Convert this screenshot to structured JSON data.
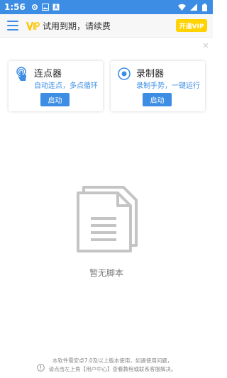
{
  "status_bar": {
    "time": "1:56",
    "icons": [
      "gear-icon",
      "image-icon",
      "text-icon",
      "wifi-icon",
      "signal-icon",
      "battery-icon"
    ]
  },
  "app_bar": {
    "trial_text": "试用到期，请续费",
    "vip_button": "开通VIP",
    "vip_color": "#ffd200"
  },
  "cards": {
    "clicker": {
      "title": "连点器",
      "description": "自动连点，多点循环",
      "button": "启动"
    },
    "recorder": {
      "title": "录制器",
      "description": "录制手势，一键运行",
      "button": "启动"
    }
  },
  "empty_state": {
    "text": "暂无脚本"
  },
  "footer": {
    "line1": "本软件需安卓7.0及以上版本使用，如遇使用问题，",
    "line2": "请点击左上角【用户中心】查看教程或联系客服解决。"
  },
  "colors": {
    "accent": "#3c8de3",
    "status_bar": "#3c8de3"
  }
}
